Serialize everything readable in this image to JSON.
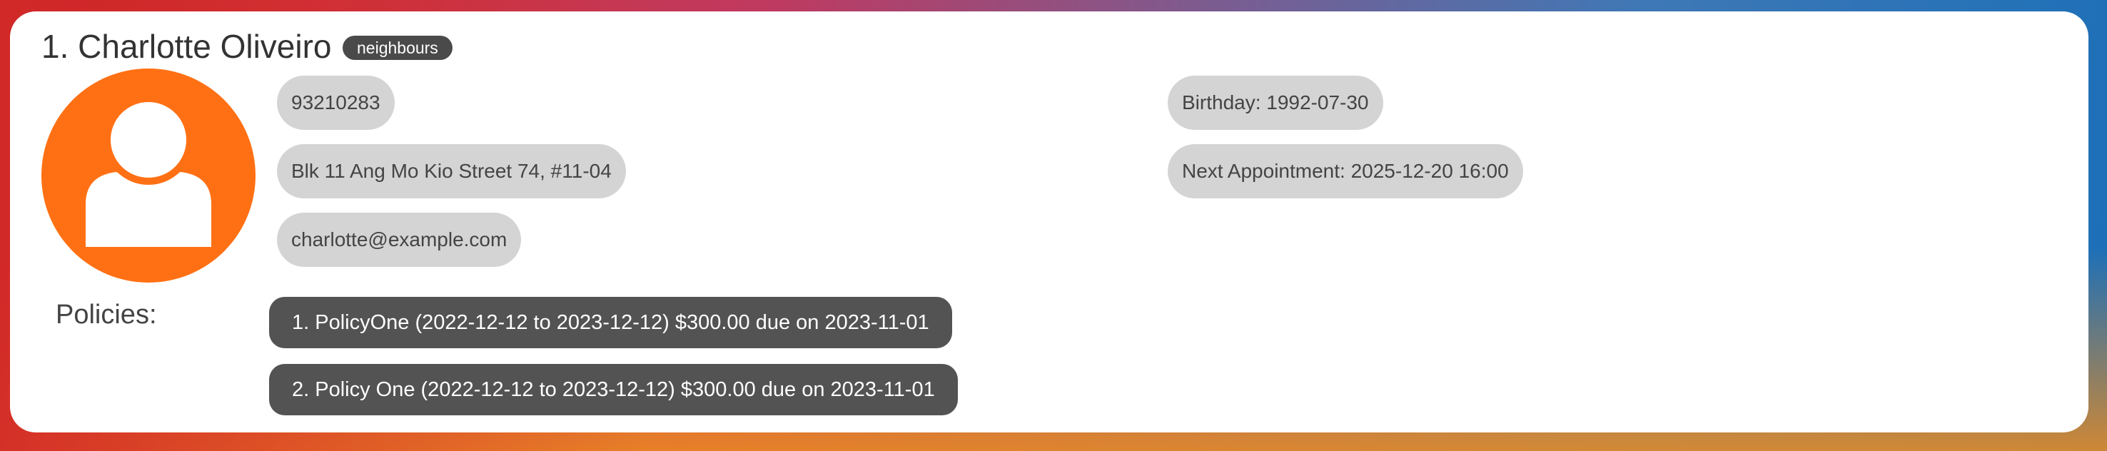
{
  "person": {
    "name": "1. Charlotte Oliveiro",
    "tags": [
      "neighbours"
    ],
    "phone": "93210283",
    "address": "Blk 11 Ang Mo Kio Street 74, #11-04",
    "email": "charlotte@example.com",
    "birthday": "Birthday: 1992-07-30",
    "next_appointment": "Next Appointment: 2025-12-20 16:00"
  },
  "policies": {
    "label": "Policies:",
    "items": [
      "1. PolicyOne (2022-12-12 to 2023-12-12) $300.00 due on 2023-11-01",
      "2. Policy One (2022-12-12 to 2023-12-12) $300.00 due on 2023-11-01"
    ]
  },
  "colors": {
    "avatar_bg": "#ff7014",
    "tag_bg": "#4a4a4a",
    "pill_bg": "#d4d4d4",
    "policy_bg": "#535353"
  },
  "icons": {
    "avatar": "user-silhouette-icon"
  }
}
